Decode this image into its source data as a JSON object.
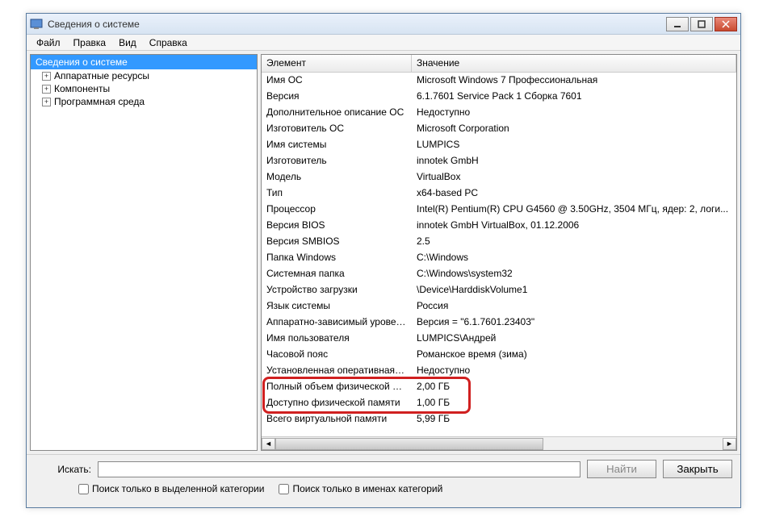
{
  "window": {
    "title": "Сведения о системе"
  },
  "menu": {
    "file": "Файл",
    "edit": "Правка",
    "view": "Вид",
    "help": "Справка"
  },
  "tree": {
    "root": "Сведения о системе",
    "items": [
      {
        "label": "Аппаратные ресурсы"
      },
      {
        "label": "Компоненты"
      },
      {
        "label": "Программная среда"
      }
    ]
  },
  "table": {
    "header_element": "Элемент",
    "header_value": "Значение",
    "rows": [
      {
        "el": "Имя ОС",
        "val": "Microsoft Windows 7 Профессиональная"
      },
      {
        "el": "Версия",
        "val": "6.1.7601 Service Pack 1 Сборка 7601"
      },
      {
        "el": "Дополнительное описание ОС",
        "val": "Недоступно"
      },
      {
        "el": "Изготовитель ОС",
        "val": "Microsoft Corporation"
      },
      {
        "el": "Имя системы",
        "val": "LUMPICS"
      },
      {
        "el": "Изготовитель",
        "val": "innotek GmbH"
      },
      {
        "el": "Модель",
        "val": "VirtualBox"
      },
      {
        "el": "Тип",
        "val": "x64-based PC"
      },
      {
        "el": "Процессор",
        "val": "Intel(R) Pentium(R) CPU G4560 @ 3.50GHz, 3504 МГц, ядер: 2, логи..."
      },
      {
        "el": "Версия BIOS",
        "val": "innotek GmbH VirtualBox, 01.12.2006"
      },
      {
        "el": "Версия SMBIOS",
        "val": "2.5"
      },
      {
        "el": "Папка Windows",
        "val": "C:\\Windows"
      },
      {
        "el": "Системная папка",
        "val": "C:\\Windows\\system32"
      },
      {
        "el": "Устройство загрузки",
        "val": "\\Device\\HarddiskVolume1"
      },
      {
        "el": "Язык системы",
        "val": "Россия"
      },
      {
        "el": "Аппаратно-зависимый уровен...",
        "val": "Версия = \"6.1.7601.23403\""
      },
      {
        "el": "Имя пользователя",
        "val": "LUMPICS\\Андрей"
      },
      {
        "el": "Часовой пояс",
        "val": "Романское время (зима)"
      },
      {
        "el": "Установленная оперативная п...",
        "val": "Недоступно"
      },
      {
        "el": "Полный объем физической па...",
        "val": "2,00 ГБ"
      },
      {
        "el": "Доступно физической памяти",
        "val": "1,00 ГБ"
      },
      {
        "el": "Всего виртуальной памяти",
        "val": "5,99 ГБ"
      }
    ]
  },
  "search": {
    "label": "Искать:",
    "find_btn": "Найти",
    "close_btn": "Закрыть",
    "chk_category": "Поиск только в выделенной категории",
    "chk_names": "Поиск только в именах категорий"
  }
}
